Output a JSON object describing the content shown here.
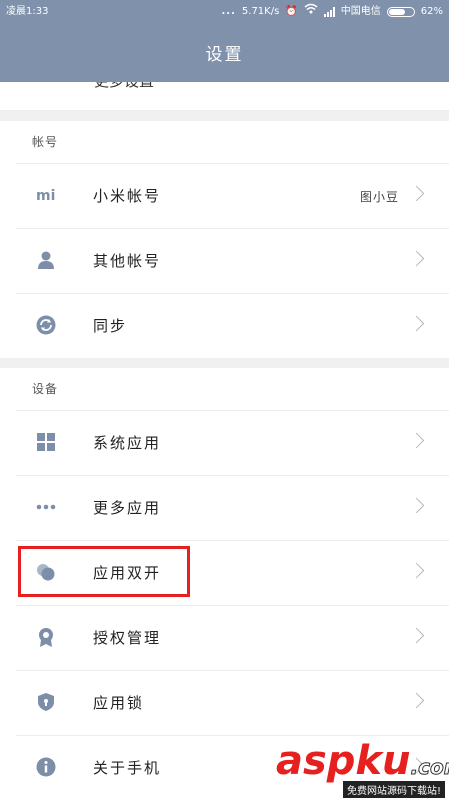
{
  "status": {
    "time": "凌晨1:33",
    "dots": "...",
    "speed": "5.71K/s",
    "carrier": "中国电信",
    "battery": "62%"
  },
  "header": {
    "title": "设置"
  },
  "partial_row": {
    "label": "更多设置"
  },
  "sections": [
    {
      "header": "帐号",
      "items": [
        {
          "icon": "mi-logo-icon",
          "label": "小米帐号",
          "value": "图小豆"
        },
        {
          "icon": "person-icon",
          "label": "其他帐号"
        },
        {
          "icon": "sync-icon",
          "label": "同步"
        }
      ]
    },
    {
      "header": "设备",
      "items": [
        {
          "icon": "grid-icon",
          "label": "系统应用"
        },
        {
          "icon": "dots-icon",
          "label": "更多应用"
        },
        {
          "icon": "dual-app-icon",
          "label": "应用双开"
        },
        {
          "icon": "badge-icon",
          "label": "授权管理"
        },
        {
          "icon": "shield-lock-icon",
          "label": "应用锁"
        },
        {
          "icon": "info-icon",
          "label": "关于手机"
        }
      ]
    }
  ],
  "watermark": {
    "main": "aspku",
    "domain": ".com",
    "sub": "免费网站源码下载站!"
  },
  "colors": {
    "header": "#7f91ab",
    "icon": "#7d8fa8",
    "highlight": "#e5201f"
  }
}
